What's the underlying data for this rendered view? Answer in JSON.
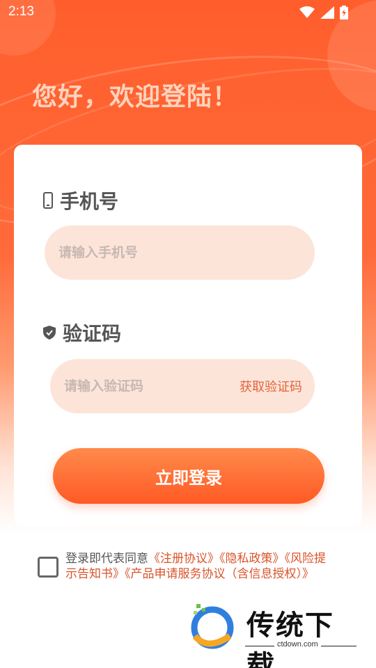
{
  "status_bar": {
    "time": "2:13",
    "icons": [
      "wifi-icon",
      "signal-icon",
      "battery-icon"
    ]
  },
  "greeting": "您好，欢迎登陆！",
  "form": {
    "phone_label": "手机号",
    "phone_placeholder": "请输入手机号",
    "phone_value": "",
    "code_label": "验证码",
    "code_placeholder": "请输入验证码",
    "code_value": "",
    "get_code_label": "获取验证码",
    "login_label": "立即登录"
  },
  "agreement": {
    "checked": false,
    "prefix": "登录即代表同意",
    "links": [
      "《注册协议》",
      "《隐私政策》",
      "《风险提示告知书》",
      "《产品申请服务协议（含信息授权）》"
    ]
  },
  "watermark": {
    "name": "传统下载",
    "url": "ctdown.com"
  },
  "colors": {
    "accent": "#ff5e2c",
    "link": "#d9542a",
    "input_bg": "#fde4d9"
  }
}
